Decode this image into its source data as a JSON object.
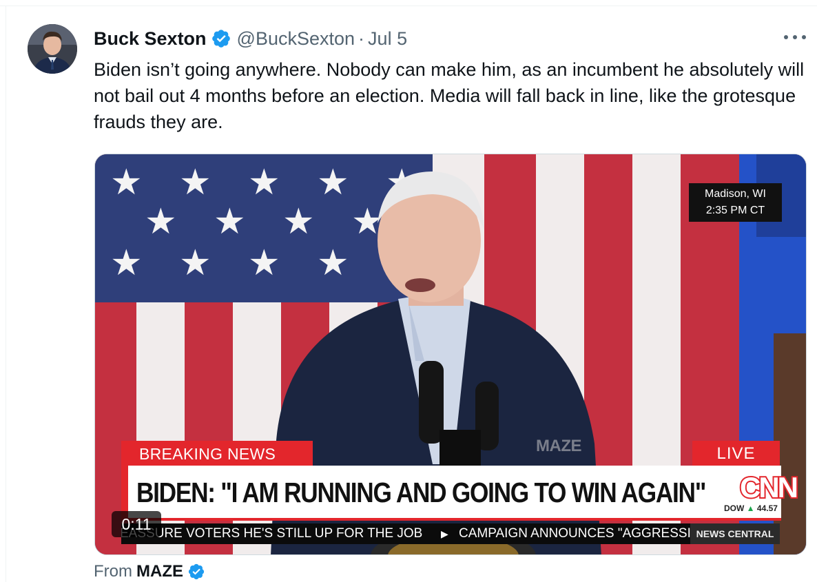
{
  "tweet": {
    "author_name": "Buck Sexton",
    "handle": "@BuckSexton",
    "separator": "·",
    "date": "Jul 5",
    "text": "Biden isn’t going anywhere. Nobody can make him, as an incumbent he absolutely will not bail out 4 months before an election. Media will fall back in line, like the grotesque frauds they are.",
    "verified": true
  },
  "video": {
    "location": "Madison, WI",
    "time": "2:35 PM CT",
    "breaking_label": "BREAKING NEWS",
    "live_label": "LIVE",
    "watermark": "MAZE",
    "headline": "BIDEN: \"I AM RUNNING AND GOING TO WIN AGAIN\"",
    "network": "CNN",
    "dow_label": "DOW",
    "dow_value": "44.57",
    "ticker_1": "EASSURE VOTERS HE'S STILL UP FOR THE JOB",
    "ticker_2": "CAMPAIGN ANNOUNCES \"AGGRESSI",
    "channel": "NEWS CENTRAL",
    "duration": "0:11"
  },
  "attribution": {
    "prefix": "From",
    "source": "MAZE",
    "verified": true
  },
  "colors": {
    "verified_blue": "#1d9bf0",
    "breaking_red": "#e3262c",
    "muted_text": "#536471"
  }
}
